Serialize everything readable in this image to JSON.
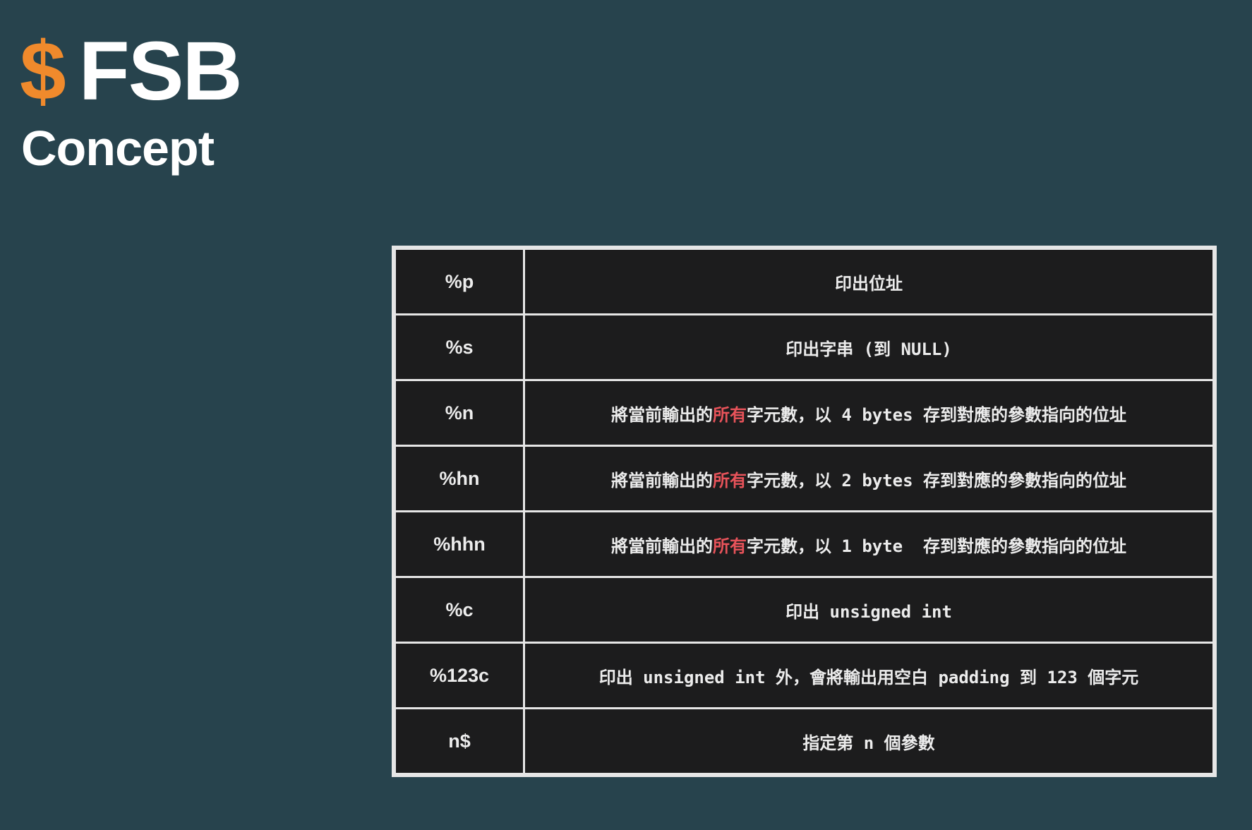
{
  "header": {
    "dollar": "$",
    "title": "FSB",
    "subtitle": "Concept"
  },
  "colors": {
    "background": "#27434d",
    "accent": "#f08a2c",
    "table_bg": "#1c1c1d",
    "table_border": "#e6e6e6",
    "highlight": "#e8535a"
  },
  "table": {
    "rows": [
      {
        "spec": "%p",
        "desc": [
          {
            "text": "印出位址",
            "hl": false
          }
        ]
      },
      {
        "spec": "%s",
        "desc": [
          {
            "text": "印出字串 (到 NULL)",
            "hl": false
          }
        ]
      },
      {
        "spec": "%n",
        "desc": [
          {
            "text": "將當前輸出的",
            "hl": false
          },
          {
            "text": "所有",
            "hl": true
          },
          {
            "text": "字元數，以 4 bytes 存到對應的參數指向的位址",
            "hl": false
          }
        ]
      },
      {
        "spec": "%hn",
        "desc": [
          {
            "text": "將當前輸出的",
            "hl": false
          },
          {
            "text": "所有",
            "hl": true
          },
          {
            "text": "字元數，以 2 bytes 存到對應的參數指向的位址",
            "hl": false
          }
        ]
      },
      {
        "spec": "%hhn",
        "desc": [
          {
            "text": "將當前輸出的",
            "hl": false
          },
          {
            "text": "所有",
            "hl": true
          },
          {
            "text": "字元數，以 1 byte  存到對應的參數指向的位址",
            "hl": false
          }
        ]
      },
      {
        "spec": "%c",
        "desc": [
          {
            "text": "印出 unsigned int",
            "hl": false
          }
        ]
      },
      {
        "spec": "%123c",
        "desc": [
          {
            "text": "印出 unsigned int 外，會將輸出用空白 padding 到 123 個字元",
            "hl": false
          }
        ]
      },
      {
        "spec": "n$",
        "desc": [
          {
            "text": "指定第 n 個參數",
            "hl": false
          }
        ]
      }
    ]
  }
}
